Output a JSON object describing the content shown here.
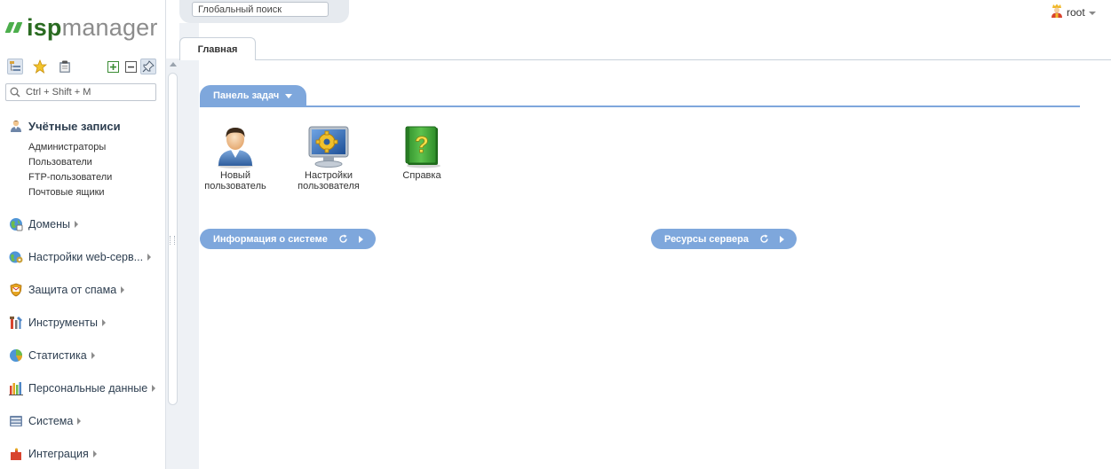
{
  "app": {
    "logo_isp": "isp",
    "logo_manager": "manager"
  },
  "header": {
    "search_placeholder": "Глобальный поиск",
    "user_name": "root"
  },
  "sidebar": {
    "search_placeholder": "Ctrl + Shift + M",
    "toolbar": [
      "tree-view-icon",
      "favorites-star-icon",
      "clipboard-icon",
      "expand-all-icon",
      "collapse-all-icon",
      "pin-icon"
    ],
    "sections": [
      {
        "label": "Учётные записи",
        "icon": "accounts-icon",
        "expanded": true,
        "items": [
          "Администраторы",
          "Пользователи",
          "FTP-пользователи",
          "Почтовые ящики"
        ]
      },
      {
        "label": "Домены",
        "icon": "domains-icon"
      },
      {
        "label": "Настройки web-серв...",
        "icon": "web-settings-icon"
      },
      {
        "label": "Защита от спама",
        "icon": "spam-protection-icon"
      },
      {
        "label": "Инструменты",
        "icon": "tools-icon"
      },
      {
        "label": "Статистика",
        "icon": "statistics-icon"
      },
      {
        "label": "Персональные данные",
        "icon": "personal-data-icon"
      },
      {
        "label": "Система",
        "icon": "system-icon"
      },
      {
        "label": "Интеграция",
        "icon": "integration-icon"
      }
    ]
  },
  "main": {
    "tabs": [
      {
        "label": "Главная",
        "active": true
      }
    ],
    "tasks_panel": {
      "label": "Панель задач",
      "tiles": [
        {
          "label_line1": "Новый",
          "label_line2": "пользователь",
          "icon": "new-user-icon"
        },
        {
          "label_line1": "Настройки",
          "label_line2": "пользователя",
          "icon": "user-settings-icon"
        },
        {
          "label_line1": "Справка",
          "label_line2": "",
          "icon": "help-book-icon"
        }
      ]
    },
    "system_info_panel": {
      "label": "Информация о системе"
    },
    "server_resources_panel": {
      "label": "Ресурсы сервера"
    }
  },
  "colors": {
    "panel_blue": "#7ea7dc",
    "logo_green": "#2a6b21",
    "logo_gray": "#8c8c8c",
    "sidebar_text": "#2d3e50"
  }
}
